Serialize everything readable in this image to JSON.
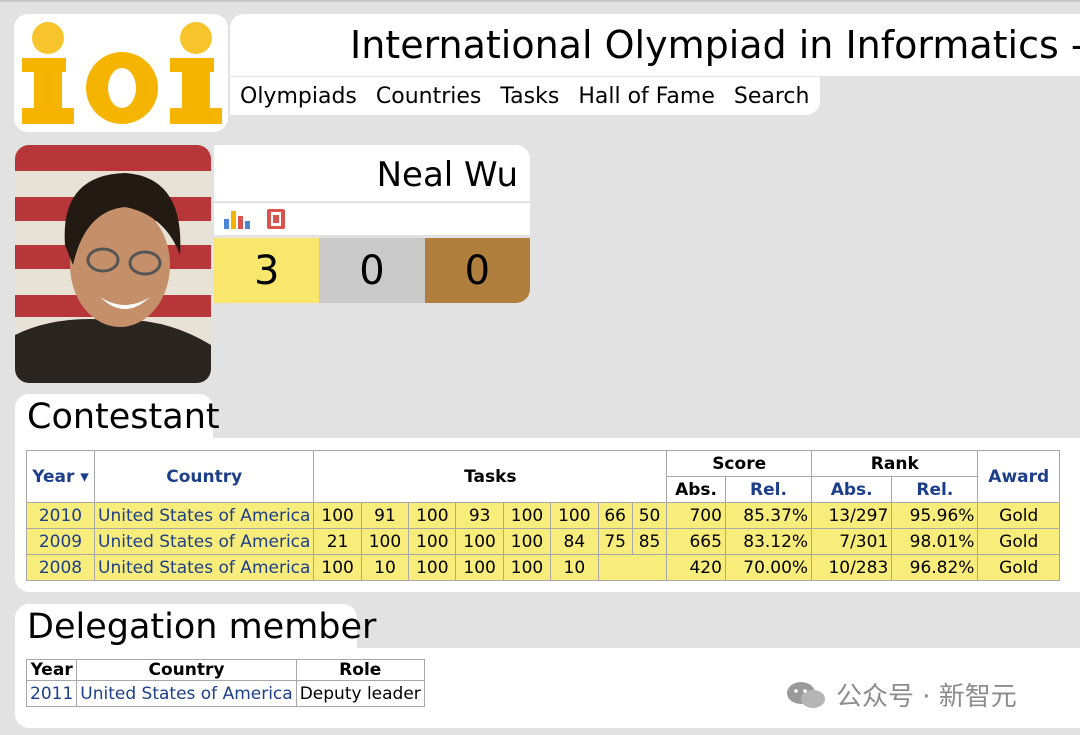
{
  "header": {
    "title": "International Olympiad in Informatics - Statistics",
    "logo_text": "ioi",
    "nav": [
      "Olympiads",
      "Countries",
      "Tasks",
      "Hall of Fame",
      "Search"
    ]
  },
  "profile": {
    "name": "Neal Wu",
    "icons": [
      "bar-chart-icon",
      "document-icon"
    ],
    "medals": {
      "gold": "3",
      "silver": "0",
      "bronze": "0"
    }
  },
  "contestant": {
    "title": "Contestant",
    "headers": {
      "year": "Year ▾",
      "country": "Country",
      "tasks": "Tasks",
      "score": "Score",
      "rank": "Rank",
      "award": "Award",
      "abs": "Abs.",
      "rel": "Rel."
    },
    "rows": [
      {
        "year": "2010",
        "country": "United States of America",
        "tasks": [
          "100",
          "91",
          "100",
          "93",
          "100",
          "100",
          "66",
          "50"
        ],
        "score_abs": "700",
        "score_rel": "85.37%",
        "rank_abs": "13/297",
        "rank_rel": "95.96%",
        "award": "Gold"
      },
      {
        "year": "2009",
        "country": "United States of America",
        "tasks": [
          "21",
          "100",
          "100",
          "100",
          "100",
          "84",
          "75",
          "85"
        ],
        "score_abs": "665",
        "score_rel": "83.12%",
        "rank_abs": "7/301",
        "rank_rel": "98.01%",
        "award": "Gold"
      },
      {
        "year": "2008",
        "country": "United States of America",
        "tasks": [
          "100",
          "10",
          "100",
          "100",
          "100",
          "10"
        ],
        "score_abs": "420",
        "score_rel": "70.00%",
        "rank_abs": "10/283",
        "rank_rel": "96.82%",
        "award": "Gold"
      }
    ]
  },
  "delegation": {
    "title": "Delegation member",
    "headers": {
      "year": "Year",
      "country": "Country",
      "role": "Role"
    },
    "rows": [
      {
        "year": "2011",
        "country": "United States of America",
        "role": "Deputy leader"
      }
    ]
  },
  "watermark": "公众号 · 新智元",
  "colors": {
    "gold": "#f9e66c",
    "silver": "#c9c9c9",
    "bronze": "#b07f3e",
    "link": "#1d3f8a",
    "logo": "#f4b400"
  }
}
